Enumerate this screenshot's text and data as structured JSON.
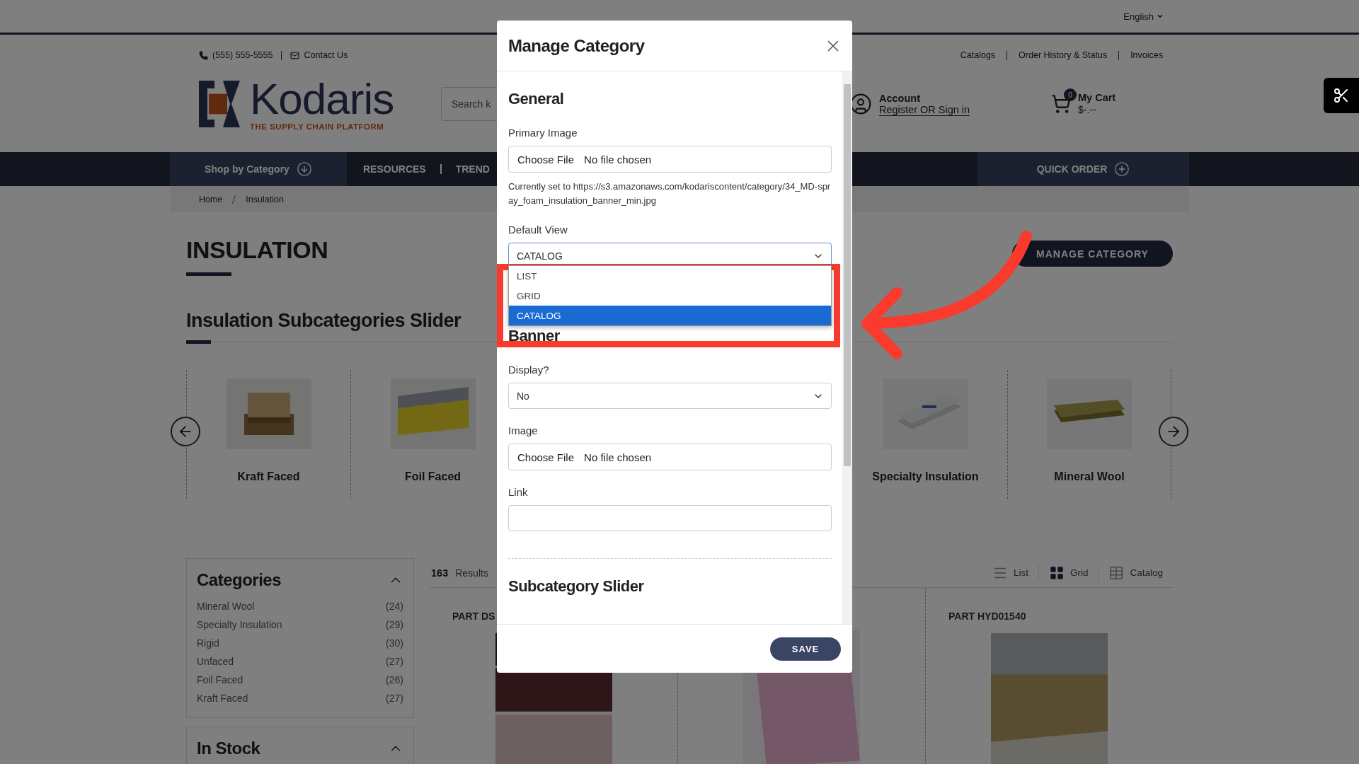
{
  "top_bar": {
    "language": "English"
  },
  "header": {
    "phone": "(555) 555-5555",
    "contact": "Contact Us",
    "links": [
      "Catalogs",
      "Order History & Status",
      "Invoices"
    ],
    "logo": {
      "name": "Kodaris",
      "tagline": "THE SUPPLY CHAIN PLATFORM"
    },
    "search": {
      "placeholder": "Search k"
    },
    "account": {
      "title": "Account",
      "link": "Register OR Sign in"
    },
    "cart": {
      "title": "My Cart",
      "count": "0",
      "total": "$-.--"
    }
  },
  "nav": {
    "shop": "Shop by Category",
    "links": [
      "RESOURCES",
      "TREND"
    ],
    "quick_order": "QUICK ORDER"
  },
  "breadcrumb": [
    "Home",
    "Insulation"
  ],
  "category": {
    "title": "INSULATION",
    "manage_button": "MANAGE CATEGORY",
    "slider_title": "Insulation Subcategories Slider",
    "slider_items": [
      "Kraft Faced",
      "Foil Faced",
      "Specialty Insulation",
      "Mineral Wool"
    ]
  },
  "filters": [
    {
      "title": "Categories",
      "expanded": true,
      "items": [
        {
          "name": "Mineral Wool",
          "count": "(24)"
        },
        {
          "name": "Specialty Insulation",
          "count": "(29)"
        },
        {
          "name": "Rigid",
          "count": "(30)"
        },
        {
          "name": "Unfaced",
          "count": "(27)"
        },
        {
          "name": "Foil Faced",
          "count": "(26)"
        },
        {
          "name": "Kraft Faced",
          "count": "(27)"
        }
      ]
    },
    {
      "title": "In Stock",
      "expanded": true
    }
  ],
  "results": {
    "count": "163",
    "label": "Results",
    "views": [
      {
        "label": "List",
        "selected": false
      },
      {
        "label": "Grid",
        "selected": true
      },
      {
        "label": "Catalog",
        "selected": false
      }
    ]
  },
  "products": [
    {
      "kind": "picture",
      "part": "PART DS"
    },
    {
      "kind": "picture"
    },
    {
      "kind": "picture",
      "part": "PART HYD01540"
    }
  ],
  "modal": {
    "title": "Manage Category",
    "save": "SAVE",
    "sections": [
      {
        "heading": "General",
        "fields": [
          {
            "kind": "file",
            "label": "Primary Image",
            "button": "Choose File",
            "value": "No file chosen",
            "note": "Currently set to https://s3.amazonaws.com/kodariscontent/category/34_MD-spray_foam_insulation_banner_min.jpg"
          },
          {
            "kind": "select",
            "label": "Default View",
            "value": "CATALOG",
            "open": true,
            "options": [
              {
                "label": "LIST",
                "selected": false
              },
              {
                "label": "GRID",
                "selected": false
              },
              {
                "label": "CATALOG",
                "selected": true
              }
            ]
          }
        ]
      },
      {
        "heading": "Banner",
        "fields": [
          {
            "kind": "select",
            "label": "Display?",
            "value": "No",
            "open": false
          },
          {
            "kind": "file",
            "label": "Image",
            "button": "Choose File",
            "value": "No file chosen"
          },
          {
            "kind": "text",
            "label": "Link"
          }
        ]
      },
      {
        "heading": "Subcategory Slider"
      }
    ]
  }
}
